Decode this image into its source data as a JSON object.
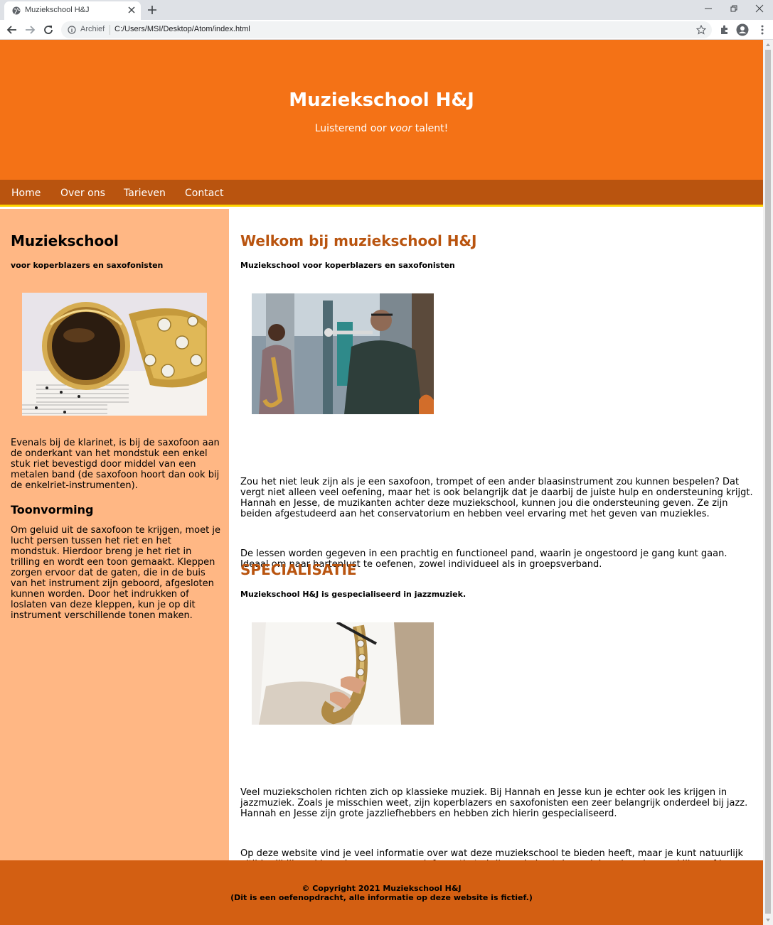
{
  "browser": {
    "tab_title": "Muziekschool H&J",
    "security_label": "Archief",
    "url": "C:/Users/MSI/Desktop/Atom/index.html"
  },
  "header": {
    "title": "Muziekschool H&J",
    "tagline_before": "Luisterend oor ",
    "tagline_em": "voor",
    "tagline_after": " talent!"
  },
  "nav": {
    "items": [
      {
        "label": "Home"
      },
      {
        "label": "Over ons"
      },
      {
        "label": "Tarieven"
      },
      {
        "label": "Contact"
      }
    ]
  },
  "sidebar": {
    "title": "Muziekschool",
    "subtitle": "voor koperblazers en saxofonisten",
    "intro": "Evenals bij de klarinet, is bij de saxofoon aan de onderkant van het mondstuk een enkel stuk riet bevestigd door middel van een metalen band (de saxofoon hoort dan ook bij de enkelriet-instrumenten).",
    "section_title": "Toonvorming",
    "section_text": "Om geluid uit de saxofoon te krijgen, moet je lucht persen tussen het riet en het mondstuk. Hierdoor breng je het riet in trilling en wordt een toon gemaakt. Kleppen zorgen ervoor dat de gaten, die in de buis van het instrument zijn geboord, afgesloten kunnen worden. Door het indrukken of loslaten van deze kleppen, kun je op dit instrument verschillende tonen maken."
  },
  "main": {
    "welcome_title": "Welkom bij muziekschool H&J",
    "welcome_subtitle": "Muziekschool voor koperblazers en saxofonisten",
    "paragraph1": "Zou het niet leuk zijn als je een saxofoon, trompet of een ander blaasinstrument zou kunnen bespelen? Dat vergt niet alleen veel oefening, maar het is ook belangrijk dat je daarbij de juiste hulp en ondersteuning krijgt. Hannah en Jesse, de muzikanten achter deze muziekschool, kunnen jou die ondersteuning geven. Ze zijn beiden afgestudeerd aan het conservatorium en hebben veel ervaring met het geven van muziekles.",
    "paragraph2": "De lessen worden gegeven in een prachtig en functioneel pand, waarin je ongestoord je gang kunt gaan. Ideaal om naar hartenlust te oefenen, zowel individueel als in groepsverband.",
    "spec_title": "SPECIALISATIE",
    "spec_subtitle": "Muziekschool H&J is gespecialiseerd in jazzmuziek.",
    "paragraph3": "Veel muziekscholen richten zich op klassieke muziek. Bij Hannah en Jesse kun je echter ook les krijgen in jazzmuziek. Zoals je misschien weet, zijn koperblazers en saxofonisten een zeer belangrijk onderdeel bij jazz. Hannah en Jesse zijn grote jazzliefhebbers en hebben zich hierin gespecialiseerd.",
    "paragraph4": "Op deze website vind je veel informatie over wat deze muziekschool te bieden heeft, maar je kunt natuurlijk altijd vrijblijvend langskomen om meer informatie te krijgen. Je kunt dan ook kennismaken en kijken of je een klik hebt met Hannah en/of Jesse."
  },
  "footer": {
    "copyright": "© Copyright 2021 Muziekschool H&J",
    "disclaimer": "(Dit is een oefenopdracht, alle informatie op deze website is fictief.)"
  }
}
